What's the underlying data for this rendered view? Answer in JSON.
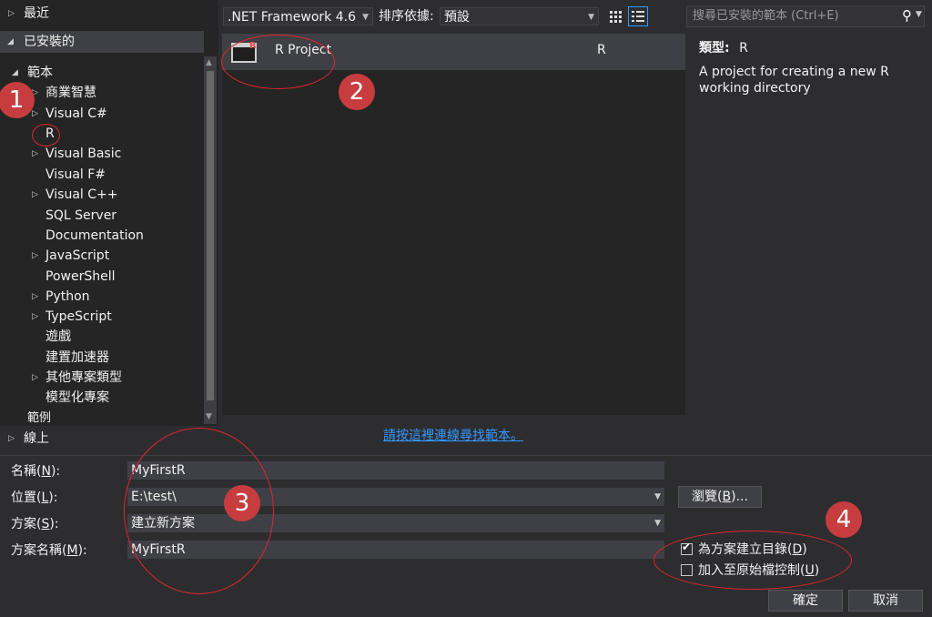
{
  "left_tree": {
    "recent": "最近",
    "installed": "已安裝的",
    "templates": "範本",
    "items": [
      "商業智慧",
      "Visual C#",
      "R",
      "Visual Basic",
      "Visual F#",
      "Visual C++",
      "SQL Server",
      "Documentation",
      "JavaScript",
      "PowerShell",
      "Python",
      "TypeScript",
      "遊戲",
      "建置加速器",
      "其他專案類型",
      "模型化專案"
    ],
    "samples_partial": "範例",
    "online": "線上"
  },
  "toolbar": {
    "framework": ".NET Framework 4.6",
    "sort_label": "排序依據:",
    "sort_value": "預設"
  },
  "search": {
    "placeholder": "搜尋已安裝的範本 (Ctrl+E)"
  },
  "template_list": {
    "items": [
      {
        "name": "R Project",
        "lang": "R"
      }
    ],
    "online_link": "請按這裡連線尋找範本。"
  },
  "details": {
    "type_label": "類型:",
    "type_value": "R",
    "description": "A project for creating a new R working directory"
  },
  "form": {
    "name_label": "名稱(",
    "name_key": "N",
    "name_label_end": "):",
    "name_value": "MyFirstR",
    "location_label": "位置(",
    "location_key": "L",
    "location_label_end": "):",
    "location_value": "E:\\test\\",
    "solution_label": "方案(",
    "solution_key": "S",
    "solution_label_end": "):",
    "solution_value": "建立新方案",
    "solution_name_label": "方案名稱(",
    "solution_name_key": "M",
    "solution_name_label_end": "):",
    "solution_name_value": "MyFirstR",
    "browse_label": "瀏覽(",
    "browse_key": "B",
    "browse_label_end": ")...",
    "create_dir_label": "為方案建立目錄(",
    "create_dir_key": "D",
    "create_dir_end": ")",
    "create_dir_checked": true,
    "source_control_label": "加入至原始檔控制(",
    "source_control_key": "U",
    "source_control_end": ")",
    "source_control_checked": false,
    "ok_label": "確定",
    "cancel_label": "取消"
  },
  "annotations": [
    "1",
    "2",
    "3",
    "4"
  ]
}
